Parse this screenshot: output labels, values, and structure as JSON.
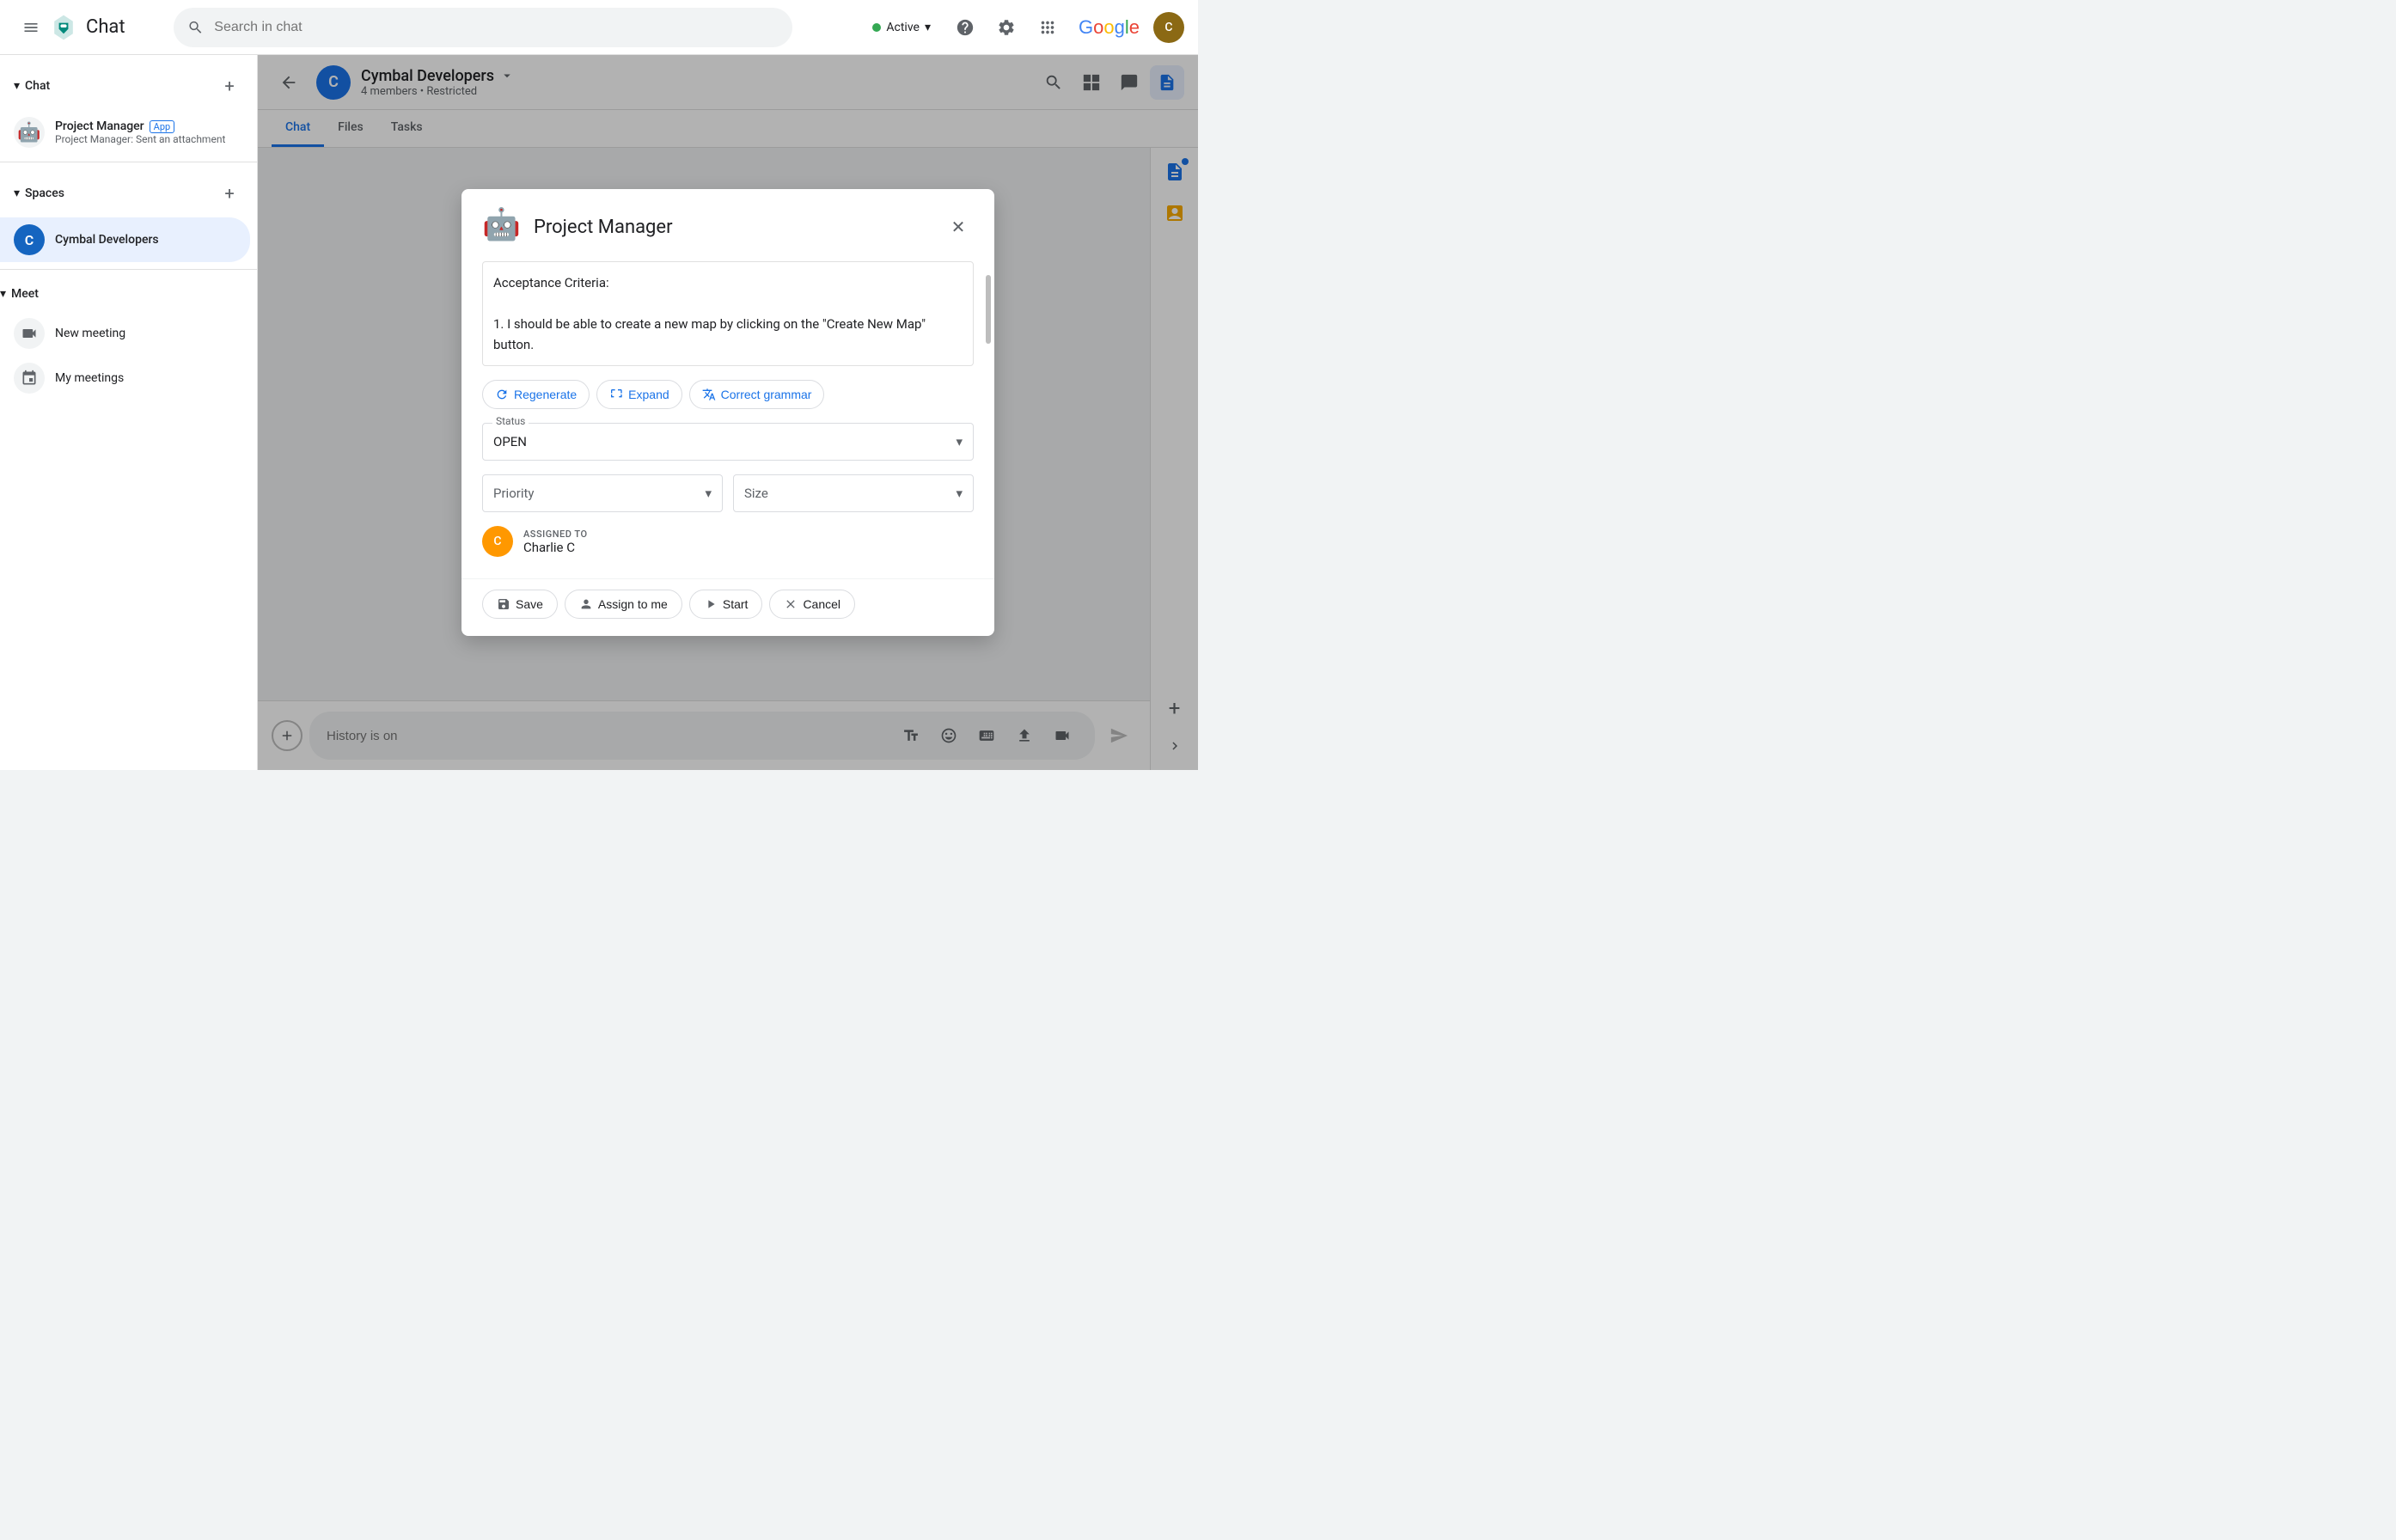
{
  "topbar": {
    "menu_label": "Main menu",
    "app_name": "Chat",
    "search_placeholder": "Search in chat",
    "status_label": "Active",
    "status_chevron": "▾",
    "help_label": "Help",
    "settings_label": "Settings",
    "apps_label": "Google apps",
    "google_text": "Google",
    "avatar_initials": "C"
  },
  "sidebar": {
    "chat_section": "Chat",
    "spaces_section": "Spaces",
    "meet_section": "Meet",
    "chat_item": {
      "name": "Project Manager",
      "badge": "App",
      "subtitle": "Project Manager: Sent an attachment"
    },
    "space_item": {
      "name": "Cymbal Developers",
      "initial": "C"
    },
    "meet_items": [
      {
        "label": "New meeting",
        "icon": "📹"
      },
      {
        "label": "My meetings",
        "icon": "📅"
      }
    ]
  },
  "chat_header": {
    "space_name": "Cymbal Developers",
    "members": "4 members",
    "restricted": "Restricted",
    "initial": "C"
  },
  "tabs": [
    {
      "label": "Chat",
      "active": true
    },
    {
      "label": "Files",
      "active": false
    },
    {
      "label": "Tasks",
      "active": false
    }
  ],
  "message_input": {
    "placeholder": "History is on"
  },
  "dialog": {
    "title": "Project Manager",
    "robot_icon": "🤖",
    "close_label": "Close",
    "content_text": "Acceptance Criteria:\n\n1. I should be able to create a new map by clicking on the \"Create New Map\" button.",
    "action_buttons": [
      {
        "label": "Regenerate",
        "icon": "↻"
      },
      {
        "label": "Expand",
        "icon": "↔"
      },
      {
        "label": "Correct grammar",
        "icon": "✍"
      }
    ],
    "status_label": "Status",
    "status_value": "OPEN",
    "priority_label": "Priority",
    "size_label": "Size",
    "assigned_to_label": "ASSIGNED TO",
    "assigned_name": "Charlie C",
    "assigned_initials": "C",
    "footer_buttons": [
      {
        "label": "Save",
        "icon": "💾"
      },
      {
        "label": "Assign to me",
        "icon": "👤"
      },
      {
        "label": "Start",
        "icon": "▶"
      },
      {
        "label": "Cancel",
        "icon": "✕"
      }
    ]
  }
}
